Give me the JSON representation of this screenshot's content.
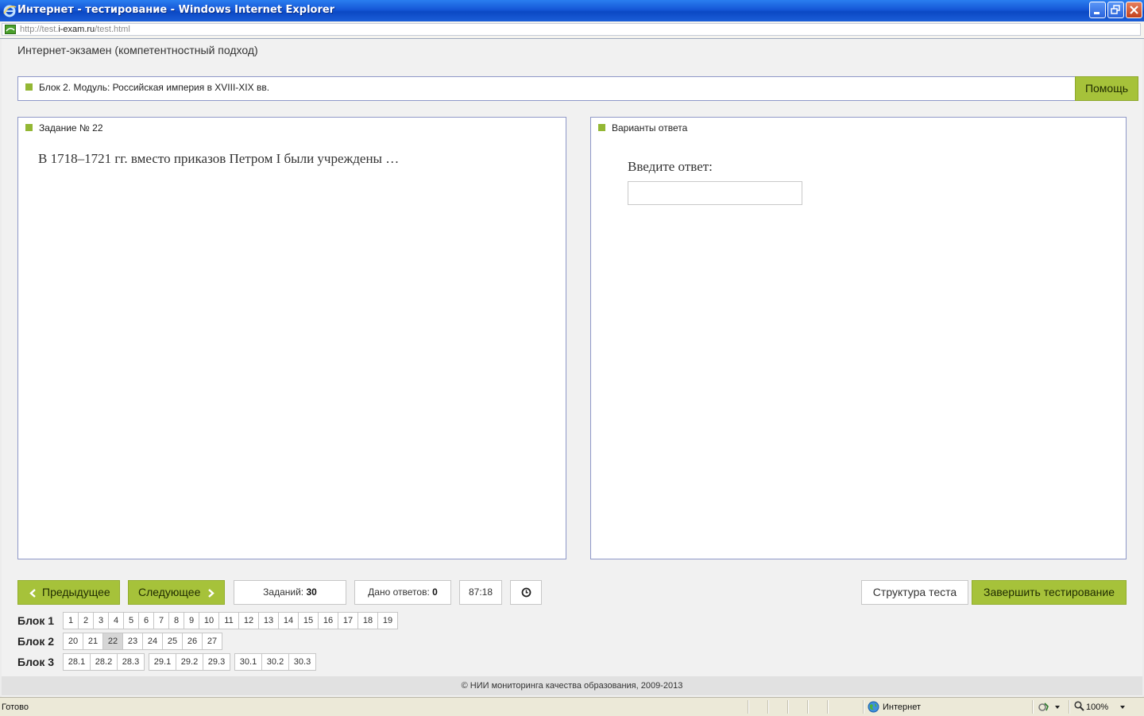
{
  "window": {
    "title": "Интернет - тестирование - Windows Internet Explorer"
  },
  "address": {
    "url_prefix": "http://test.",
    "url_host": "i-exam.ru",
    "url_suffix": "/test.html"
  },
  "page": {
    "app_title": "Интернет-экзамен (компетентностный подход)",
    "block_label": "Блок 2. Модуль: Российская империя в XVIII-XIX вв.",
    "help_label": "Помощь"
  },
  "task": {
    "title": "Задание № 22",
    "question": "В 1718–1721 гг. вместо приказов Петром I были учреждены …"
  },
  "answer": {
    "title": "Варианты ответа",
    "prompt": "Введите ответ:",
    "value": ""
  },
  "controls": {
    "prev_label": "Предыдущее",
    "next_label": "Следующее",
    "tasks_label": "Заданий:",
    "tasks_value": "30",
    "answers_label": "Дано ответов:",
    "answers_value": "0",
    "timer": "87:18",
    "structure_label": "Структура теста",
    "finish_label": "Завершить тестирование"
  },
  "nav": {
    "blocks": [
      {
        "label": "Блок 1",
        "items": [
          "1",
          "2",
          "3",
          "4",
          "5",
          "6",
          "7",
          "8",
          "9",
          "10",
          "11",
          "12",
          "13",
          "14",
          "15",
          "16",
          "17",
          "18",
          "19"
        ]
      },
      {
        "label": "Блок 2",
        "items": [
          "20",
          "21",
          "22",
          "23",
          "24",
          "25",
          "26",
          "27"
        ]
      },
      {
        "label": "Блок 3",
        "items": [
          "28.1",
          "28.2",
          "28.3",
          "29.1",
          "29.2",
          "29.3",
          "30.1",
          "30.2",
          "30.3"
        ]
      }
    ],
    "current": "22"
  },
  "footer": {
    "text": "© НИИ мониторинга качества образования, 2009-2013"
  },
  "statusbar": {
    "status": "Готово",
    "zone": "Интернет",
    "zoom": "100%"
  },
  "colors": {
    "accent_green": "#a6c23a",
    "marker_green": "#93b734",
    "panel_border": "#8f98c8",
    "titlebar_blue": "#1557d6"
  },
  "icons": {
    "browser": "ie-logo-icon",
    "page": "page-icon",
    "prev": "chevron-left-icon",
    "next": "chevron-right-icon",
    "clock": "clock-icon",
    "zone": "globe-icon",
    "zoom": "zoom-icon"
  }
}
